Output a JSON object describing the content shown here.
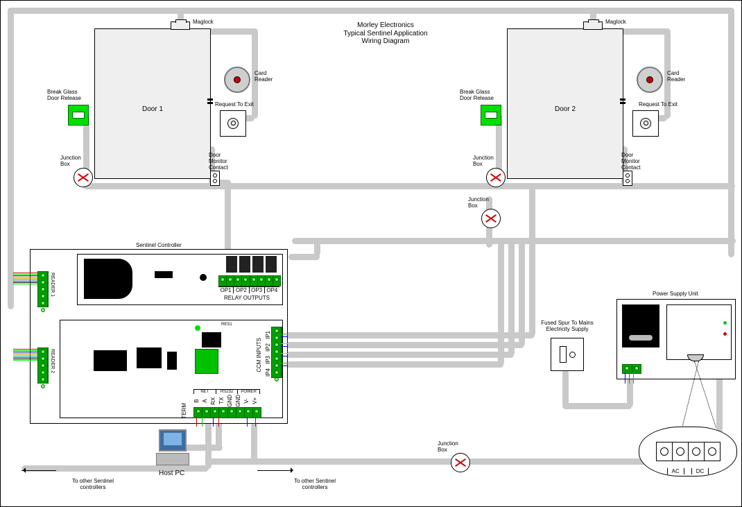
{
  "title": {
    "line1": "Morley Electronics",
    "line2": "Typical Sentinel Application",
    "line3": "Wiring Diagram"
  },
  "door1": {
    "name": "Door 1",
    "maglock": "Maglock",
    "card_reader": "Card Reader",
    "break_glass": "Break Glass Door Release",
    "rte": "Request To Exit",
    "dmc": "Door Monitor Contact",
    "jbox": "Junction Box"
  },
  "door2": {
    "name": "Door 2",
    "maglock": "Maglock",
    "card_reader": "Card Reader",
    "break_glass": "Break Glass Door Release",
    "rte": "Request To Exit",
    "dmc": "Door Monitor Contact",
    "jbox": "Junction Box"
  },
  "jbox3": "Junction Box",
  "jbox4": "Junction Box",
  "controller": {
    "title": "Sentinel Controller",
    "reader1": "READER 1",
    "reader2": "READER 2",
    "relay_outputs_label": "RELAY OUTPUTS",
    "relay_outputs": [
      "OP1",
      "OP2",
      "OP3",
      "OP4"
    ],
    "ccm_inputs_label": "CCM INPUTS",
    "ccm_inputs": [
      "IP4",
      "IP3",
      "IP2",
      "IP1"
    ],
    "comm_pins": [
      "B",
      "A",
      "RX",
      "TX",
      "GND",
      "GND",
      "V-",
      "V+"
    ],
    "comm_groups": [
      "NET",
      "RS232",
      "POWER"
    ],
    "term": "TERM",
    "res1": "RES1"
  },
  "psu": {
    "title": "Power Supply Unit",
    "ac": "AC",
    "dc": "DC"
  },
  "spur": "Fused Spur To Mains Electricity Supply",
  "hostpc": "Host PC",
  "footnote_left": "To other Sentinel controllers",
  "footnote_right": "To other Sentinel controllers"
}
